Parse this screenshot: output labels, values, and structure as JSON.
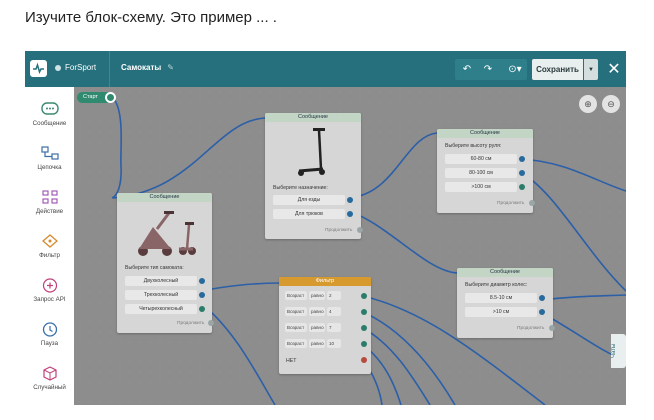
{
  "question": "Изучите блок-схему. Это пример ... .",
  "topbar": {
    "brand": "ForSport",
    "breadcrumb": "Самокаты",
    "save_label": "Сохранить"
  },
  "sidebar": {
    "items": [
      {
        "label": "Сообщение",
        "icon": "message-icon"
      },
      {
        "label": "Цепочка",
        "icon": "chain-icon"
      },
      {
        "label": "Действие",
        "icon": "action-icon"
      },
      {
        "label": "Фильтр",
        "icon": "filter-icon"
      },
      {
        "label": "Запрос API",
        "icon": "api-icon"
      },
      {
        "label": "Пауза",
        "icon": "pause-icon"
      },
      {
        "label": "Случайный",
        "icon": "random-icon"
      }
    ]
  },
  "start_label": "Старт",
  "nodes": {
    "msg1": {
      "header": "Сообщение",
      "question": "Выберите тип самоката:",
      "options": [
        "Двухколесный",
        "Трехколесный",
        "Четырехколесный"
      ],
      "continue": "Продолжить"
    },
    "msg2": {
      "header": "Сообщение",
      "question": "Выберите назначение:",
      "options": [
        "Для езды",
        "Для трюков"
      ],
      "continue": "Продолжить"
    },
    "msg3": {
      "header": "Сообщение",
      "question": "Выберите высоту руля:",
      "options": [
        "60-80 см",
        "80-100 см",
        ">100 см"
      ],
      "continue": "Продолжить"
    },
    "msg4": {
      "header": "Сообщение",
      "question": "Выберите диаметр колес:",
      "options": [
        "8.5-10 см",
        ">10 см"
      ],
      "continue": "Продолжить"
    },
    "filter": {
      "header": "Фильтр",
      "rows": [
        {
          "field": "Возраст",
          "op": "равно",
          "value": "2"
        },
        {
          "field": "Возраст",
          "op": "равно",
          "value": "4"
        },
        {
          "field": "Возраст",
          "op": "равно",
          "value": "7"
        },
        {
          "field": "Возраст",
          "op": "равно",
          "value": "10"
        }
      ],
      "else_label": "НЕТ"
    }
  },
  "chats_label": "Чаты",
  "colors": {
    "topbar": "#25707c",
    "filter_header": "#d69a2e",
    "message_header": "#c3d6c5",
    "connector": "#2b5fa8",
    "start": "#2f8a6f"
  }
}
